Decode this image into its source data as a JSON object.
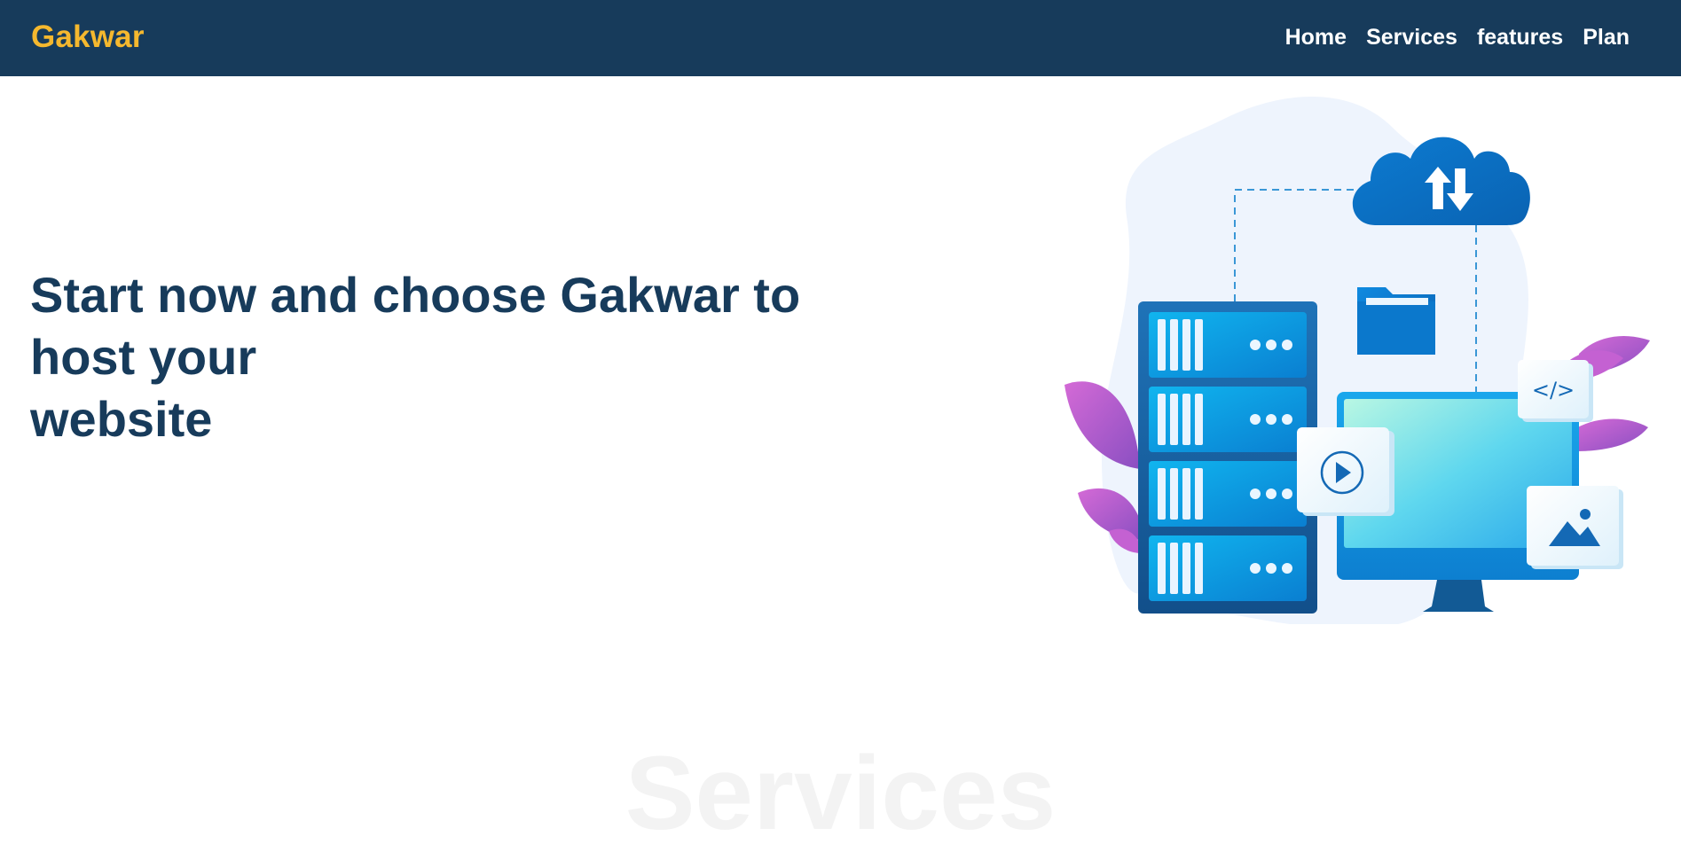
{
  "navbar": {
    "brand": "Gakwar",
    "links": [
      {
        "label": "Home"
      },
      {
        "label": "Services"
      },
      {
        "label": "features"
      },
      {
        "label": "Plan"
      }
    ]
  },
  "hero": {
    "title_lines": [
      "Start now and choose Gakwar to",
      "host your",
      "website"
    ]
  },
  "illustration": {
    "code_icon_text": "</>",
    "icons": [
      "cloud-sync-icon",
      "folder-icon",
      "play-icon",
      "code-icon",
      "image-icon",
      "server-rack",
      "monitor"
    ]
  },
  "sections": {
    "services_heading": "Services"
  },
  "colors": {
    "navbar_bg": "#173b5b",
    "brand": "#f5b82e",
    "hero_text": "#173b5b",
    "accent_blue": "#0a7fd1",
    "leaf_purple": "#b25ad0"
  }
}
